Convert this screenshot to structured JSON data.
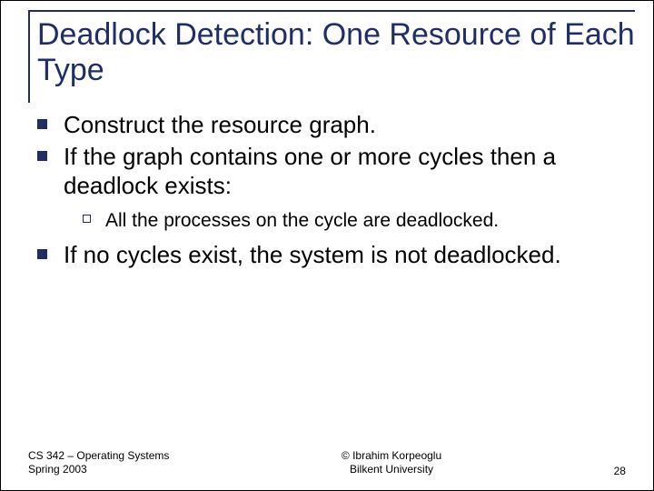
{
  "title": "Deadlock Detection: One Resource of Each Type",
  "bullets": {
    "b0": "Construct the resource graph.",
    "b1": "If the graph contains one or more cycles then a deadlock exists:",
    "b1a": "All the processes on the cycle are deadlocked.",
    "b2": "If no cycles exist, the system is not deadlocked."
  },
  "footer": {
    "left_line1": "CS 342 – Operating Systems",
    "left_line2": "Spring 2003",
    "center_line1": "© Ibrahim Korpeoglu",
    "center_line2": "Bilkent University",
    "page": "28"
  }
}
